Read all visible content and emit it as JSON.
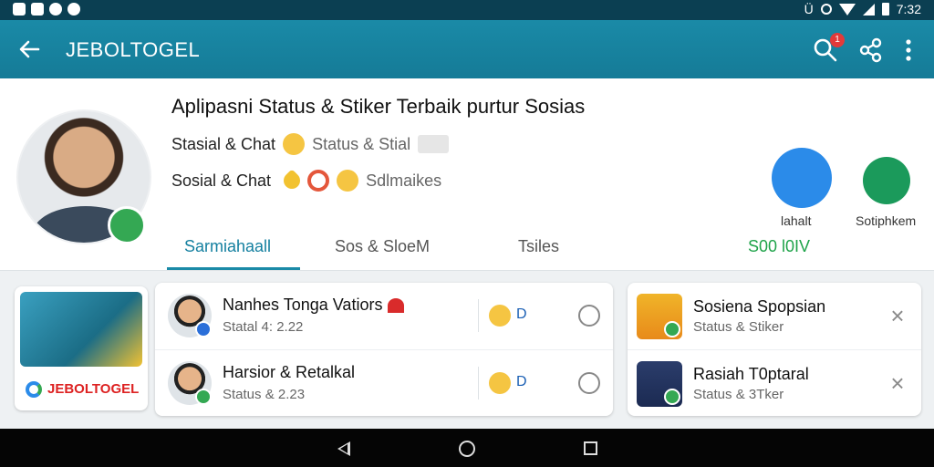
{
  "status_bar": {
    "time": "7:32",
    "indicator": "Ü"
  },
  "app_bar": {
    "title": "JEBOLTOGEL",
    "notification_count": "1",
    "icons": [
      "back-arrow-icon",
      "search-icon",
      "share-icon",
      "more-vert-icon"
    ]
  },
  "profile": {
    "title": "Aplipasni Status & Stiker Terbaik purtur Sosias",
    "line1_label": "Stasial & Chat",
    "line1_muted": "Status & Stial",
    "line2_label": "Sosial & Chat",
    "line2_muted": "Sdlmaikes",
    "actions": [
      {
        "label": "lahalt",
        "color": "#2b8be9"
      },
      {
        "label": "Sotiphkem",
        "color": "#1b9a5b"
      }
    ]
  },
  "tabs": [
    {
      "label": "Sarmiahaall",
      "active": true
    },
    {
      "label": "Sos & SloeM",
      "active": false
    },
    {
      "label": "Tsiles",
      "active": false
    },
    {
      "label": "S00 l0IV",
      "active": false
    }
  ],
  "promo": {
    "label": "JEBOLTOGEL"
  },
  "list": [
    {
      "title": "Nanhes Tonga Vatiors",
      "subtitle": "Statal 4: 2.22",
      "count": "D"
    },
    {
      "title": "Harsior & Retalkal",
      "subtitle": "Status & 2.23",
      "count": "D"
    }
  ],
  "right_list": [
    {
      "title": "Sosiena Spopsian",
      "subtitle": "Status & Stiker"
    },
    {
      "title": "Rasiah T0ptaral",
      "subtitle": "Status & 3Tker"
    }
  ],
  "nav_bar": {
    "icons": [
      "nav-back-icon",
      "nav-home-icon",
      "nav-recents-icon"
    ]
  },
  "colors": {
    "app_bar": "#1a8aa7",
    "status_bar": "#0b3f52",
    "accent_tab": "#1580a0",
    "green_tab": "#1fa34a",
    "badge": "#e23a3a"
  }
}
